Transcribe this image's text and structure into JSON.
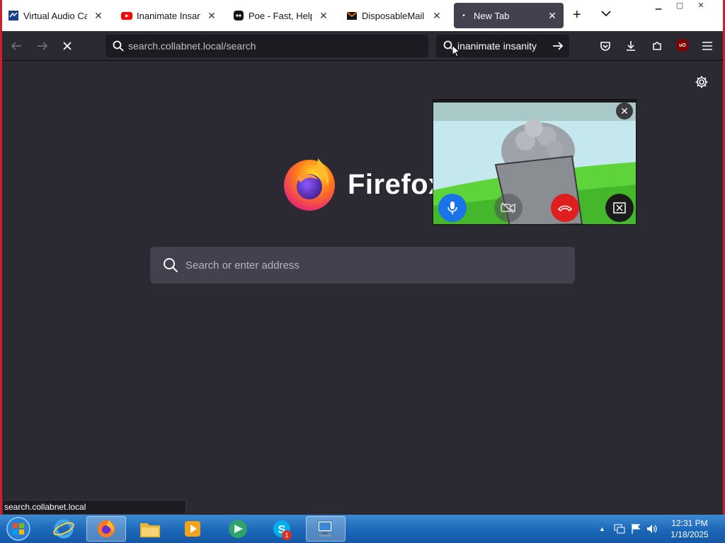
{
  "tabs": [
    {
      "title": "Virtual Audio Cable",
      "icon": "vac-icon",
      "active": false
    },
    {
      "title": "Inanimate Insanity",
      "icon": "youtube-icon",
      "active": false
    },
    {
      "title": "Poe - Fast, Helpful",
      "icon": "poe-icon",
      "active": false
    },
    {
      "title": "DisposableMail | Di",
      "icon": "mail-icon",
      "active": false
    },
    {
      "title": "New Tab",
      "icon": "dot-icon",
      "active": true
    }
  ],
  "toolbar": {
    "url": "search.collabnet.local/search",
    "search_query": "inanimate insanity"
  },
  "content": {
    "brand": "Firefox",
    "search_placeholder": "Search or enter address"
  },
  "video_call": {
    "controls": [
      "microphone-icon",
      "camera-off-icon",
      "hang-up-icon",
      "exit-fullscreen-icon"
    ]
  },
  "status_bar": {
    "text": "search.collabnet.local"
  },
  "taskbar": {
    "time": "12:31 PM",
    "date": "1/18/2025",
    "skype_badge": "1"
  },
  "colors": {
    "firefox_bg": "#2b2a33",
    "tab_active": "#42414d",
    "hangup_red": "#e01e1e",
    "mic_blue": "#1a73e8"
  }
}
